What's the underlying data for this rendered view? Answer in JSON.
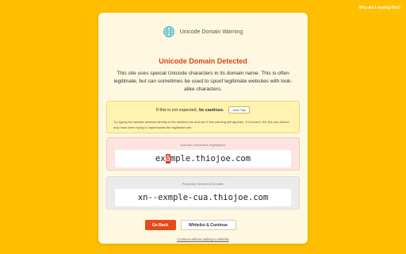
{
  "help_link": "Why am I seeing this?",
  "header": {
    "icon": "globe-icon",
    "title": "Unicode Domain Warning"
  },
  "headline": "Unicode Domain Detected",
  "description": "This site uses special Unicode characters in its domain name. This is often legitimate, but can sometimes be used to spoof legitimate websites with look-alike characters.",
  "tips": {
    "prefix": "If this is not expected,",
    "emphasis": "be cautious.",
    "hide_label": "Hide Tips",
    "text": "Try typing the website address directly in the address bar and see if this warning still appears. If it doesn't, the link you clicked may have been trying to impersonate the legitimate site."
  },
  "unicode_section": {
    "label": "Unicode Characters Highlighted:",
    "before": "ex",
    "highlight": "ä",
    "after": "mple.thiojoe.com"
  },
  "punycode_section": {
    "label": "Punycode Version of Domain:",
    "value": "xn--exmple-cua.thiojoe.com"
  },
  "buttons": {
    "back": "Go Back",
    "whitelist": "Whitelist & Continue"
  },
  "continue_link": "Continue without adding to whitelist",
  "colors": {
    "background": "#FFBF00",
    "card": "#FFF8E1",
    "headline": "#D84315",
    "highlight": "#E53935",
    "primary_button": "#E64A19"
  }
}
